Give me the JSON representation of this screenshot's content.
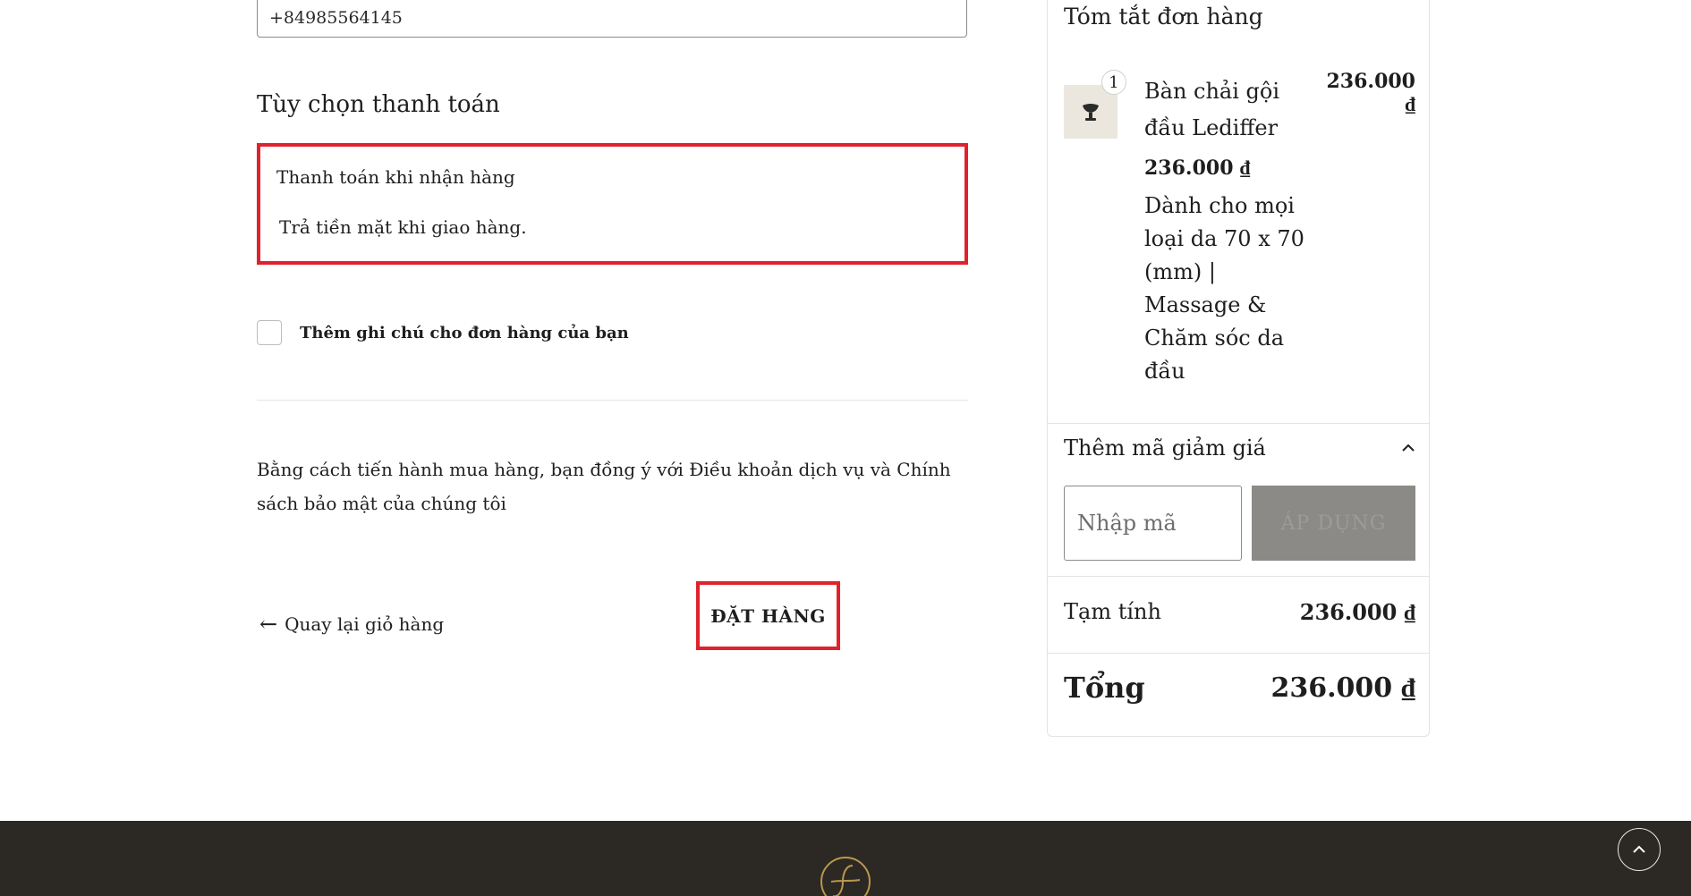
{
  "contact": {
    "phone_value": "+84985564145"
  },
  "payment": {
    "heading": "Tùy chọn thanh toán",
    "method_title": "Thanh toán khi nhận hàng",
    "method_description": "Trả tiền mặt khi giao hàng."
  },
  "order_note": {
    "label": "Thêm ghi chú cho đơn hàng của bạn",
    "checked": false
  },
  "terms_text": "Bằng cách tiến hành mua hàng, bạn đồng ý với Điều khoản dịch vụ và Chính sách bảo mật của chúng tôi",
  "actions": {
    "back_label": "Quay lại giỏ hàng",
    "back_icon": "arrow-left-icon",
    "place_order_label": "ĐẶT HÀNG"
  },
  "summary": {
    "title": "Tóm tắt đơn hàng",
    "item": {
      "quantity": "1",
      "name": "Bàn chải gội đầu Lediffer",
      "unit_price": "236.000 ₫",
      "line_total": "236.000 ₫",
      "variant": "Dành cho mọi loại da 70 x 70 (mm) | Massage & Chăm sóc da đầu",
      "thumbnail_icon": "brush-product-icon"
    },
    "discount": {
      "label": "Thêm mã giảm giá",
      "toggle_icon": "chevron-up-icon",
      "placeholder": "Nhập mã",
      "apply_label": "ÁP DỤNG"
    },
    "subtotal_label": "Tạm tính",
    "subtotal_value": "236.000 ₫",
    "total_label": "Tổng",
    "total_value": "236.000 ₫"
  },
  "footer": {
    "logo_icon": "brand-logo-icon",
    "scroll_top_icon": "chevron-up-icon"
  },
  "colors": {
    "highlight_border": "#e0222c",
    "footer_bg": "#2c2823",
    "logo_gold": "#b9974f",
    "apply_disabled_bg": "#8c8a87"
  }
}
